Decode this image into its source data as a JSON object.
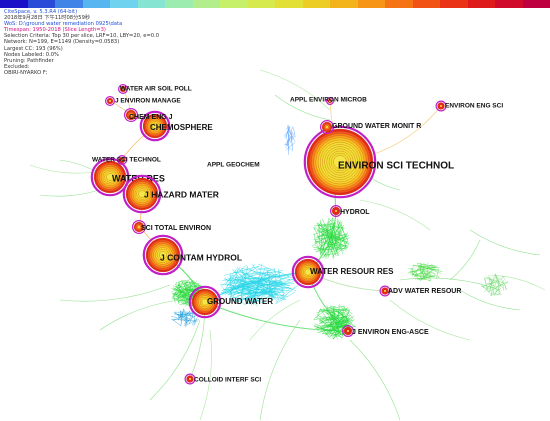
{
  "header": {
    "timezone_slices": [
      "#1a10c8",
      "#2a4ad8",
      "#3f84e6",
      "#56b6ef",
      "#6fd3ef",
      "#86e4d2",
      "#9cecaf",
      "#b2ef8c",
      "#c6ef6a",
      "#d6ea4e",
      "#e2df36",
      "#eccd25",
      "#f3b41b",
      "#f69516",
      "#f67314",
      "#f25214",
      "#ea3316",
      "#df1a1a",
      "#d00a2a",
      "#be0040"
    ],
    "lines": [
      {
        "text": "CiteSpace, v. 5.3.R4 (64-bit)",
        "color": "blue"
      },
      {
        "text": "2018年9月28日 下午11时08分59秒",
        "color": "normal"
      },
      {
        "text": "WoS: D:\\ground water remediation 0925\\data",
        "color": "blue"
      },
      {
        "text": "Timespan: 1950-2018 (Slice Length=3)",
        "color": "pink"
      },
      {
        "text": "Selection Criteria: Top 30 per slice, LRF=10, LBY=20, e=0.0",
        "color": "normal"
      },
      {
        "text": "Network: N=199, E=1149 (Density=0.0583)",
        "color": "normal"
      },
      {
        "text": "Largest CC: 193 (96%)",
        "color": "normal"
      },
      {
        "text": "Nodes Labeled: 0.0%",
        "color": "normal"
      },
      {
        "text": "Pruning: Pathfinder",
        "color": "normal"
      },
      {
        "text": "Excluded:",
        "color": "normal"
      },
      {
        "text": "    OBIRI-NYARKO F;",
        "color": "normal"
      }
    ]
  },
  "network": {
    "nodes": [
      {
        "id": "environ-sci-technol",
        "label": "ENVIRON SCI TECHNOL",
        "size": "xl"
      },
      {
        "id": "water-res",
        "label": "WATER RES",
        "size": "l"
      },
      {
        "id": "j-hazard-mater",
        "label": "J HAZARD MATER",
        "size": "l"
      },
      {
        "id": "j-contam-hydrol",
        "label": "J CONTAM HYDROL",
        "size": "l"
      },
      {
        "id": "chemosphere",
        "label": "CHEMOSPHERE",
        "size": "m"
      },
      {
        "id": "water-resour-res",
        "label": "WATER RESOUR RES",
        "size": "m"
      },
      {
        "id": "ground-water",
        "label": "GROUND WATER",
        "size": "m"
      },
      {
        "id": "sci-total-environ",
        "label": "SCI TOTAL ENVIRON",
        "size": "s"
      },
      {
        "id": "chem-eng-j",
        "label": "CHEM ENG J",
        "size": "s"
      },
      {
        "id": "ground-water-monit-r",
        "label": "GROUND WATER MONIT R",
        "size": "s"
      },
      {
        "id": "hydrol",
        "label": "HYDROL",
        "size": "xs"
      },
      {
        "id": "adv-water-resour",
        "label": "ADV WATER RESOUR",
        "size": "xs"
      },
      {
        "id": "j-environ-eng-asce",
        "label": "J ENVIRON ENG-ASCE",
        "size": "xs"
      },
      {
        "id": "colloid-interf-sci",
        "label": "COLLOID INTERF SCI",
        "size": "xs"
      },
      {
        "id": "water-air-soil-poll",
        "label": "WATER AIR SOIL POLL",
        "size": "xs"
      },
      {
        "id": "j-environ-manage",
        "label": "J ENVIRON MANAGE",
        "size": "xs"
      },
      {
        "id": "water-sci-technol",
        "label": "WATER SCI TECHNOL",
        "size": "xs"
      },
      {
        "id": "appl-environ-microb",
        "label": "APPL ENVIRON MICROB",
        "size": "xs"
      },
      {
        "id": "environ-eng-sci",
        "label": "ENVIRON ENG SCI",
        "size": "xs"
      },
      {
        "id": "appl-geochem",
        "label": "APPL GEOCHEM",
        "size": "xs"
      }
    ]
  }
}
